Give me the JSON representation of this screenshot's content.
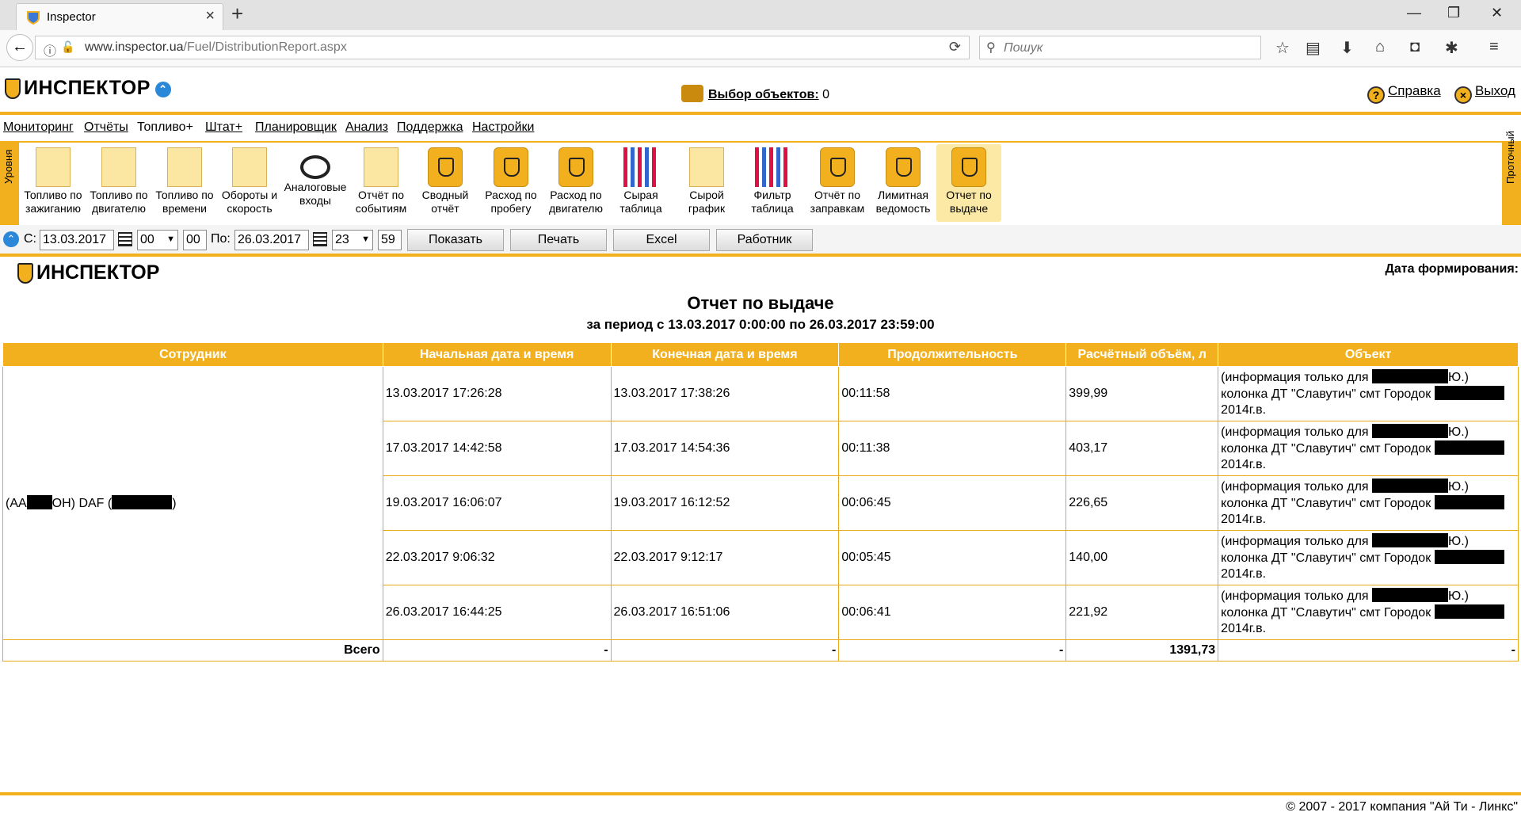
{
  "browser": {
    "tab_title": "Inspector",
    "url_host": "www.inspector.ua",
    "url_path": "/Fuel/DistributionReport.aspx",
    "search_placeholder": "Пошук"
  },
  "header": {
    "logo_text": "ИНСПЕКТОР",
    "objects_label": "Выбор объектов:",
    "objects_count": "0",
    "help_label": "Справка",
    "exit_label": "Выход"
  },
  "menu": [
    "Мониторинг",
    "Отчёты",
    "Топливо+",
    "Штат+",
    "Планировщик",
    "Анализ",
    "Поддержка",
    "Настройки"
  ],
  "toolbar": {
    "left_side_tab": "Уровня",
    "right_side_tab": "Проточный",
    "items": [
      {
        "line1": "Топливо по",
        "line2": "зажиганию"
      },
      {
        "line1": "Топливо по",
        "line2": "двигателю"
      },
      {
        "line1": "Топливо по",
        "line2": "времени"
      },
      {
        "line1": "Обороты и",
        "line2": "скорость"
      },
      {
        "line1": "Аналоговые",
        "line2": "входы"
      },
      {
        "line1": "Отчёт по",
        "line2": "событиям"
      },
      {
        "line1": "Сводный",
        "line2": "отчёт"
      },
      {
        "line1": "Расход по",
        "line2": "пробегу"
      },
      {
        "line1": "Расход по",
        "line2": "двигателю"
      },
      {
        "line1": "Сырая",
        "line2": "таблица"
      },
      {
        "line1": "Сырой",
        "line2": "график"
      },
      {
        "line1": "Фильтр",
        "line2": "таблица"
      },
      {
        "line1": "Отчёт по",
        "line2": "заправкам"
      },
      {
        "line1": "Лимитная",
        "line2": "ведомость"
      },
      {
        "line1": "Отчет по",
        "line2": "выдаче"
      }
    ]
  },
  "filters": {
    "from_label": "С:",
    "from_date": "13.03.2017",
    "from_hour": "00",
    "from_min": "00",
    "to_label": "По:",
    "to_date": "26.03.2017",
    "to_hour": "23",
    "to_min": "59",
    "buttons": [
      "Показать",
      "Печать",
      "Excel",
      "Работник"
    ]
  },
  "report": {
    "logo_text": "ИНСПЕКТОР",
    "gen_date_label": "Дата формирования:",
    "title": "Отчет по выдаче",
    "period": "за период с 13.03.2017 0:00:00 по 26.03.2017 23:59:00",
    "columns": [
      "Сотрудник",
      "Начальная дата и время",
      "Конечная дата и время",
      "Продолжительность",
      "Расчётный объём, л",
      "Объект"
    ],
    "employee_p1": "(AA",
    "employee_p2": "OH) DAF (",
    "employee_p3": ")",
    "object_l1a": "(информация только для",
    "object_l1b": "Ю.)",
    "object_l2": "колонка ДТ \"Славутич\" смт Городок",
    "object_l3": "2014г.в.",
    "rows": [
      {
        "start": "13.03.2017 17:26:28",
        "end": "13.03.2017 17:38:26",
        "duration": "00:11:58",
        "volume": "399,99"
      },
      {
        "start": "17.03.2017 14:42:58",
        "end": "17.03.2017 14:54:36",
        "duration": "00:11:38",
        "volume": "403,17"
      },
      {
        "start": "19.03.2017 16:06:07",
        "end": "19.03.2017 16:12:52",
        "duration": "00:06:45",
        "volume": "226,65"
      },
      {
        "start": "22.03.2017 9:06:32",
        "end": "22.03.2017 9:12:17",
        "duration": "00:05:45",
        "volume": "140,00"
      },
      {
        "start": "26.03.2017 16:44:25",
        "end": "26.03.2017 16:51:06",
        "duration": "00:06:41",
        "volume": "221,92"
      }
    ],
    "total_label": "Всего",
    "total_dash": "-",
    "total_volume": "1391,73"
  },
  "footer": "© 2007 - 2017 компания \"Ай Ти - Линкс\""
}
